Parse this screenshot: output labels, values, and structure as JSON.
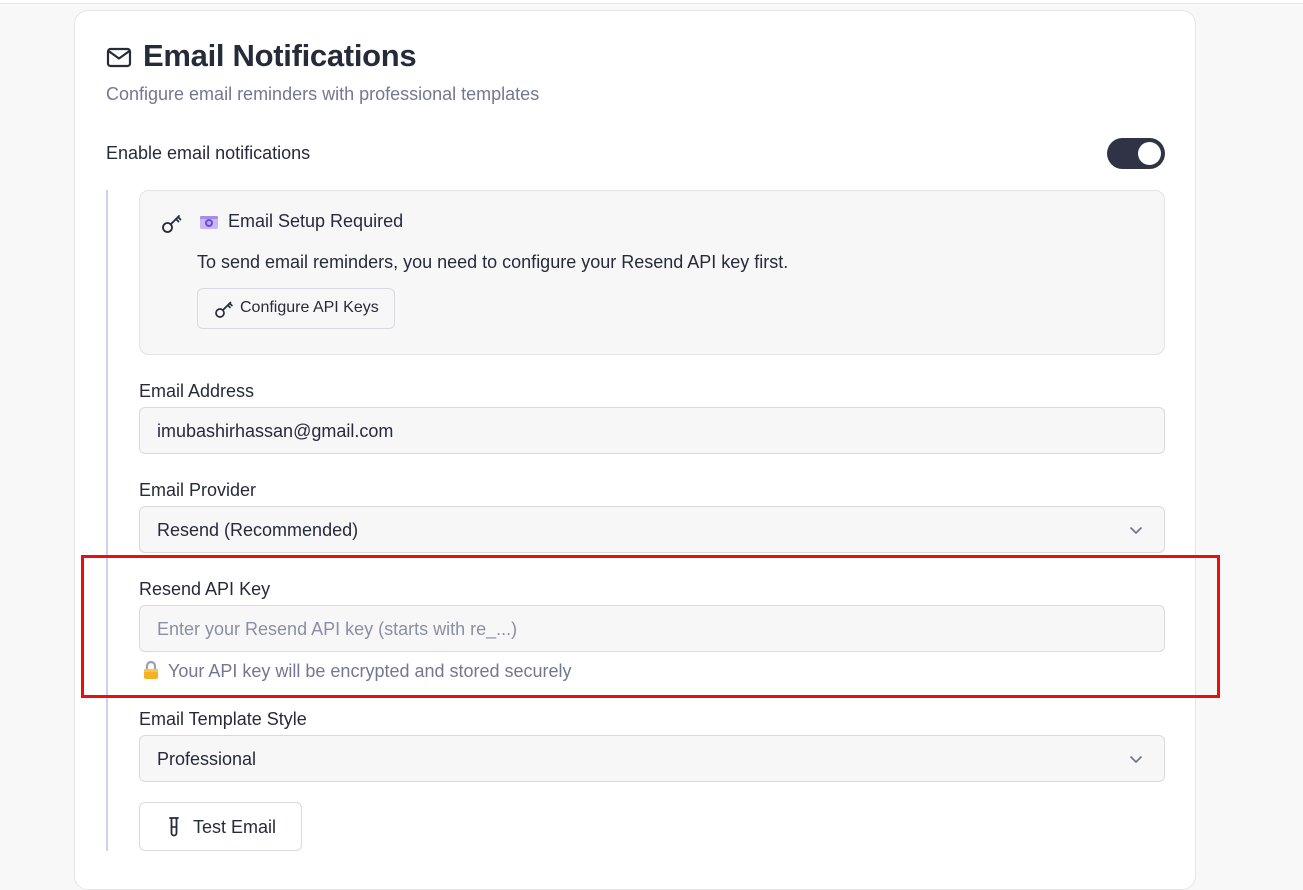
{
  "header": {
    "title": "Email Notifications",
    "subtitle": "Configure email reminders with professional templates",
    "icon": "mail-icon"
  },
  "toggle": {
    "label": "Enable email notifications",
    "enabled": true
  },
  "setup_notice": {
    "icon": "key-icon",
    "emoji": "camera-emoji-icon",
    "title": "Email Setup Required",
    "text": "To send email reminders, you need to configure your Resend API key first.",
    "button_label": "Configure API Keys"
  },
  "email_address": {
    "label": "Email Address",
    "value": "imubashirhassan@gmail.com"
  },
  "email_provider": {
    "label": "Email Provider",
    "value": "Resend (Recommended)"
  },
  "api_key": {
    "label": "Resend API Key",
    "value": "",
    "placeholder": "Enter your Resend API key (starts with re_...)",
    "note": "Your API key will be encrypted and stored securely"
  },
  "template_style": {
    "label": "Email Template Style",
    "value": "Professional"
  },
  "test_button": {
    "label": "Test Email",
    "icon": "test-tube-icon"
  },
  "colors": {
    "accent_dark": "#2f3345",
    "highlight": "#e8100f",
    "indent_line": "#c9d3f0"
  }
}
